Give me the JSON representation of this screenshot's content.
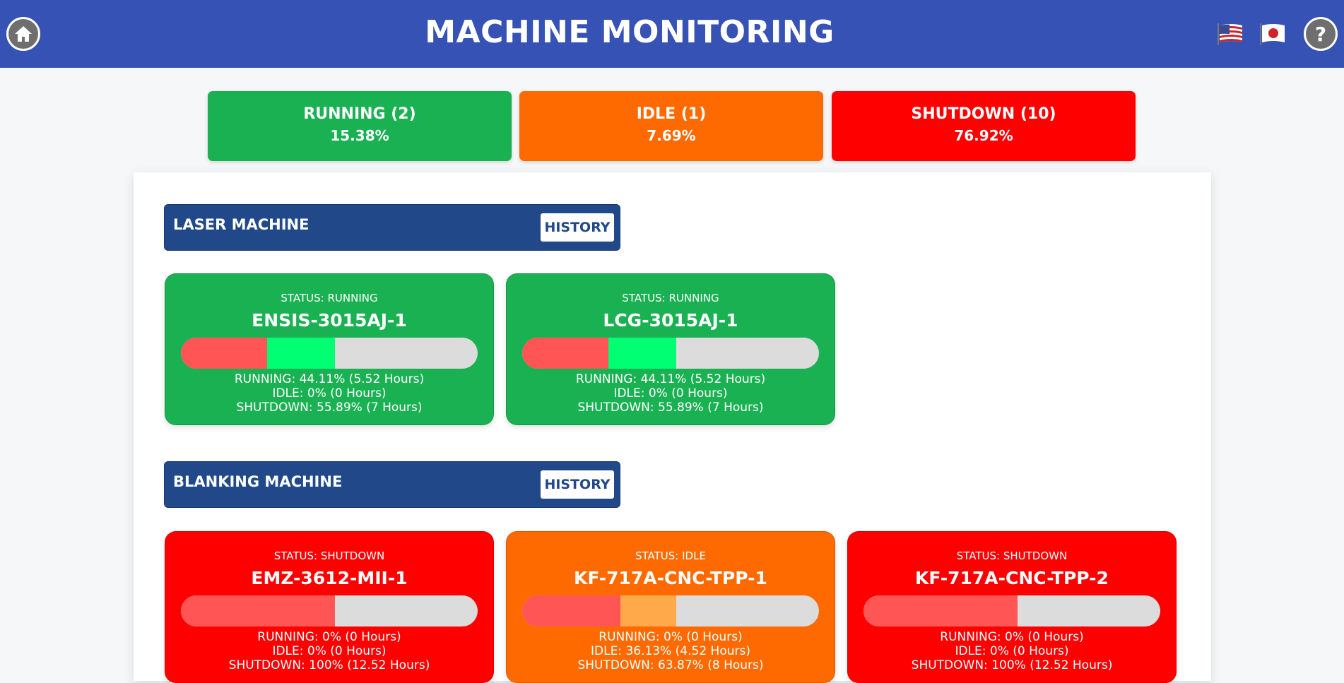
{
  "header": {
    "title": "MACHINE MONITORING",
    "home_icon": "home-icon",
    "help_icon": "question-mark-icon",
    "flags": [
      "us-flag-icon",
      "japan-flag-icon"
    ],
    "color": "#3752b5"
  },
  "summary": {
    "running": {
      "label": "RUNNING (2)",
      "percent": "15.38%",
      "color": "#1ab152"
    },
    "idle": {
      "label": "IDLE (1)",
      "percent": "7.69%",
      "color": "#ff6a00"
    },
    "shutdown": {
      "label": "SHUTDOWN (10)",
      "percent": "76.92%",
      "color": "#ff0000"
    }
  },
  "groups": [
    {
      "title": "LASER MACHINE",
      "history_label": "HISTORY",
      "machines": [
        {
          "status": "STATUS: RUNNING",
          "name": "ENSIS-3015AJ-1",
          "bar_fractions": {
            "shutdown": 0.29,
            "running": 0.23,
            "idle": 0.0
          },
          "running_text": "RUNNING: 44.11% (5.52 Hours)",
          "idle_text": "IDLE: 0% (0 Hours)",
          "shutdown_text": "SHUTDOWN: 55.89% (7 Hours)"
        },
        {
          "status": "STATUS: RUNNING",
          "name": "LCG-3015AJ-1",
          "bar_fractions": {
            "shutdown": 0.29,
            "running": 0.23,
            "idle": 0.0
          },
          "running_text": "RUNNING: 44.11% (5.52 Hours)",
          "idle_text": "IDLE: 0% (0 Hours)",
          "shutdown_text": "SHUTDOWN: 55.89% (7 Hours)"
        }
      ]
    },
    {
      "title": "BLANKING MACHINE",
      "history_label": "HISTORY",
      "machines": [
        {
          "status": "STATUS: SHUTDOWN",
          "name": "EMZ-3612-MII-1",
          "bar_fractions": {
            "shutdown": 0.52,
            "running": 0.0,
            "idle": 0.0
          },
          "running_text": "RUNNING: 0% (0 Hours)",
          "idle_text": "IDLE: 0% (0 Hours)",
          "shutdown_text": "SHUTDOWN: 100% (12.52 Hours)"
        },
        {
          "status": "STATUS: IDLE",
          "name": "KF-717A-CNC-TPP-1",
          "bar_fractions": {
            "shutdown": 0.33,
            "running": 0.0,
            "idle": 0.19
          },
          "running_text": "RUNNING: 0% (0 Hours)",
          "idle_text": "IDLE: 36.13% (4.52 Hours)",
          "shutdown_text": "SHUTDOWN: 63.87% (8 Hours)"
        },
        {
          "status": "STATUS: SHUTDOWN",
          "name": "KF-717A-CNC-TPP-2",
          "bar_fractions": {
            "shutdown": 0.52,
            "running": 0.0,
            "idle": 0.0
          },
          "running_text": "RUNNING: 0% (0 Hours)",
          "idle_text": "IDLE: 0% (0 Hours)",
          "shutdown_text": "SHUTDOWN: 100% (12.52 Hours)"
        }
      ]
    }
  ]
}
